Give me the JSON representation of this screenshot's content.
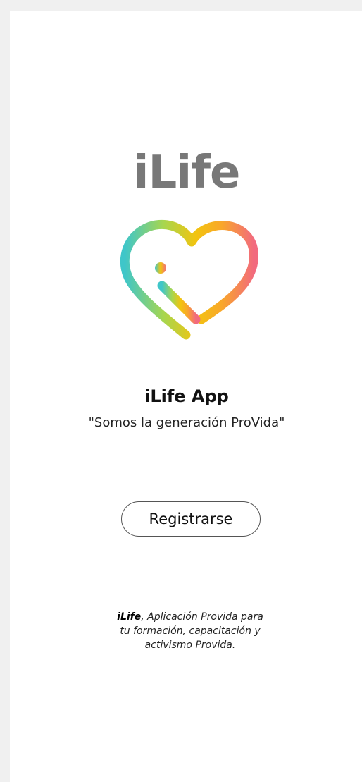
{
  "logo": {
    "wordmark": "iLife",
    "heart_icon": "heart-gradient-logo-icon",
    "wordmark_color": "#787878",
    "gradient_colors": [
      "#3fc6c9",
      "#a7d64f",
      "#f2c40f",
      "#f9a72a",
      "#f26a7e"
    ]
  },
  "app": {
    "name": "iLife App",
    "tagline": "\"Somos la generación ProVida\""
  },
  "actions": {
    "register_label": "Registrarse"
  },
  "footer": {
    "brand": "iLife",
    "line1_rest": ", Aplicación Provida para",
    "line2": "tu formación, capacitación y",
    "line3": "activismo Provida."
  }
}
